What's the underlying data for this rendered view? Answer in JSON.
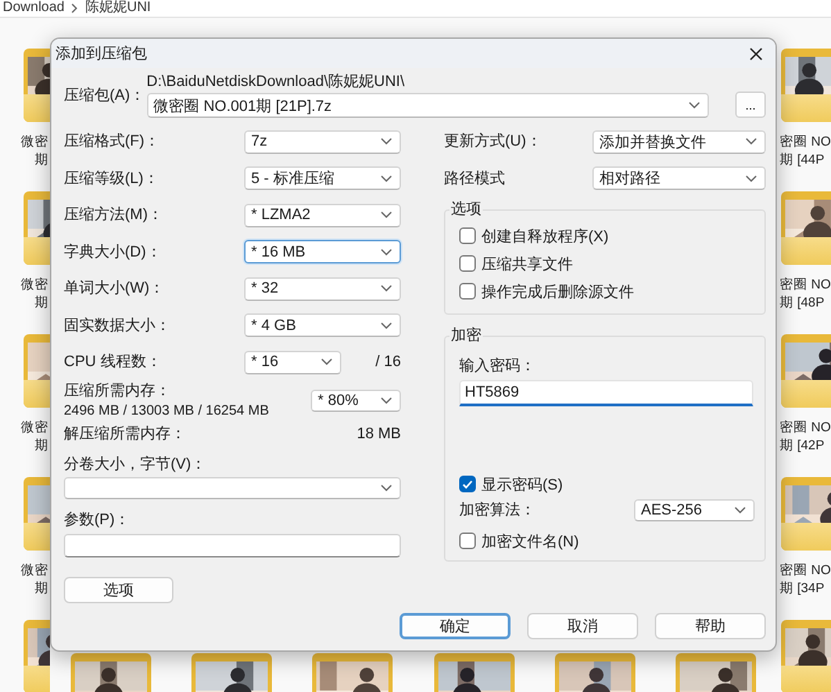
{
  "explorer": {
    "breadcrumb": [
      "Download",
      "陈妮妮UNI"
    ],
    "left_labels": [
      {
        "line_1": "微密",
        "line_2": "期"
      },
      {
        "line_1": "微密",
        "line_2": "期"
      },
      {
        "line_1": "微密",
        "line_2": "期"
      },
      {
        "line_1": "微密",
        "line_2": "期"
      }
    ],
    "right_labels": [
      {
        "line_1": "密圈 NO",
        "line_2": "期 [44P"
      },
      {
        "line_1": "密圈 NO",
        "line_2": "期 [48P"
      },
      {
        "line_1": "密圈 NO",
        "line_2": "期 [42P"
      },
      {
        "line_1": "密圈 NO",
        "line_2": "期 [34P"
      }
    ]
  },
  "dialog": {
    "title": "添加到压缩包",
    "archive": {
      "label": "压缩包(A)：",
      "path": "D:\\BaiduNetdiskDownload\\陈妮妮UNI\\",
      "value": "微密圈 NO.001期 [21P].7z",
      "browse": "..."
    },
    "settings": [
      {
        "kind": "select",
        "label": "压缩格式(F)：",
        "value": "7z",
        "focused": false
      },
      {
        "kind": "select",
        "label": "压缩等级(L)：",
        "value": "5 - 标准压缩",
        "focused": false
      },
      {
        "kind": "select",
        "label": "压缩方法(M)：",
        "value": "* LZMA2",
        "focused": false
      },
      {
        "kind": "select",
        "label": "字典大小(D)：",
        "value": "* 16 MB",
        "focused": true
      },
      {
        "kind": "select",
        "label": "单词大小(W)：",
        "value": "* 32",
        "focused": false
      },
      {
        "kind": "select",
        "label": "固实数据大小：",
        "value": "* 4 GB",
        "focused": false
      },
      {
        "kind": "select_max",
        "label": "CPU 线程数：",
        "value": "* 16",
        "max": "/ 16",
        "focused": false
      }
    ],
    "memory": {
      "label": "压缩所需内存：",
      "detail": "2496 MB / 13003 MB / 16254 MB",
      "value": "* 80%"
    },
    "decompress_memory": {
      "label": "解压缩所需内存：",
      "value": "18 MB"
    },
    "volume": {
      "label": "分卷大小，字节(V)："
    },
    "parameters": {
      "label": "参数(P)："
    },
    "options_button": "选项",
    "update": {
      "label": "更新方式(U)：",
      "value": "添加并替换文件"
    },
    "path_mode": {
      "label": "路径模式",
      "value": "相对路径"
    },
    "options_group": {
      "title": "选项",
      "checks": [
        {
          "label": "创建自释放程序(X)",
          "checked": false
        },
        {
          "label": "压缩共享文件",
          "checked": false
        },
        {
          "label": "操作完成后删除源文件",
          "checked": false
        }
      ]
    },
    "encryption": {
      "title": "加密",
      "password_label": "输入密码：",
      "password": "HT5869",
      "show_password": {
        "label": "显示密码(S)",
        "checked": true
      },
      "method": {
        "label": "加密算法：",
        "value": "AES-256"
      },
      "encrypt_names": {
        "label": "加密文件名(N)",
        "checked": false
      }
    },
    "buttons": [
      {
        "label": "确定",
        "focused": true
      },
      {
        "label": "取消",
        "focused": false
      },
      {
        "label": "帮助",
        "focused": false
      }
    ]
  }
}
